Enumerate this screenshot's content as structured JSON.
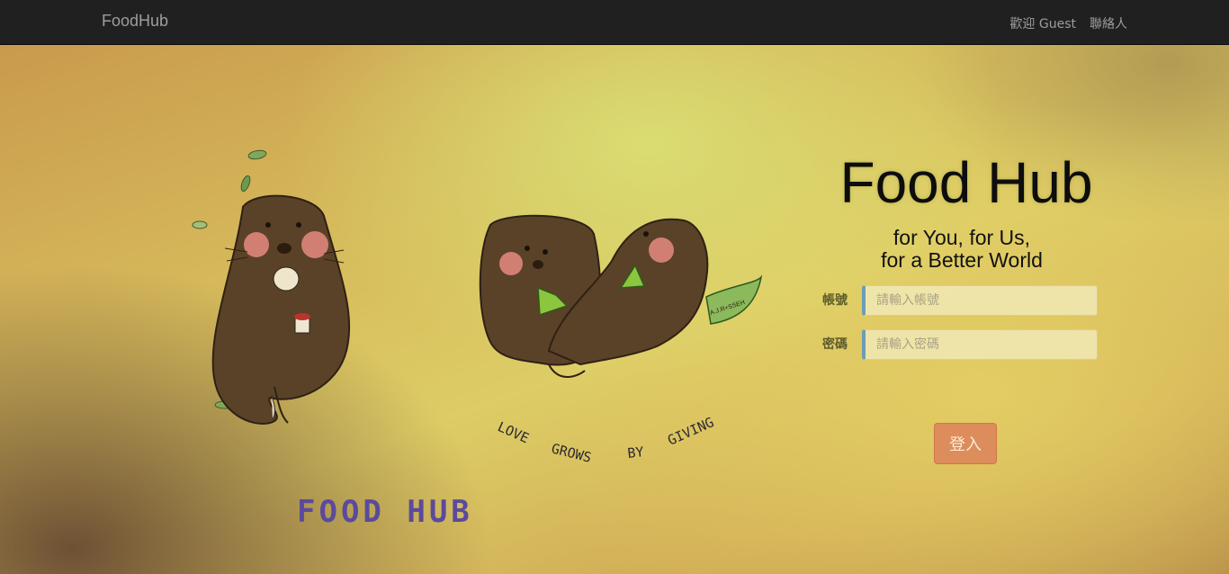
{
  "navbar": {
    "brand": "FoodHub",
    "welcome": "歡迎 Guest",
    "contact": "聯絡人"
  },
  "illustration": {
    "slogan_words": [
      "LOVE",
      "GROWS",
      "BY",
      "GIVING"
    ],
    "logo_text": "FOOD HUB",
    "signature": "A.J.R+SSEH",
    "colors": {
      "animal": "#5a4228",
      "cheek": "#e88a80",
      "leaf": "#7fa85a",
      "watermelon": "#8cc63e"
    }
  },
  "login": {
    "title": "Food Hub",
    "tagline_line1": "for You, for Us,",
    "tagline_line2": "for a Better World",
    "account_label": "帳號",
    "account_placeholder": "請輸入帳號",
    "account_value": "",
    "password_label": "密碼",
    "password_placeholder": "請輸入密碼",
    "password_value": "",
    "submit_label": "登入"
  },
  "colors": {
    "navbar_bg": "#202020",
    "button_bg": "#dd8c5c",
    "input_accent": "#6d9db4"
  }
}
